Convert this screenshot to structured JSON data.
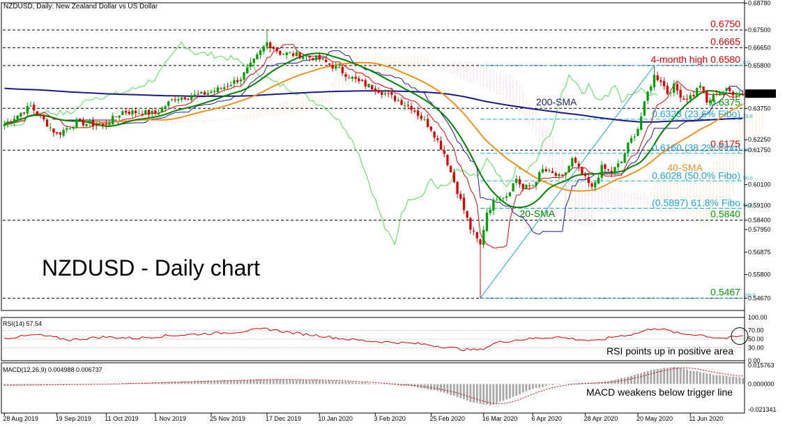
{
  "header": {
    "symbol_line": "NZDUSD, Daily:  New Zealand Dollar vs US Dollar",
    "big_title": "NZDUSD - Daily chart"
  },
  "colors": {
    "bull": "#00a000",
    "bear": "#e00000",
    "sma20": "#008000",
    "sma40": "#f0921e",
    "sma200": "#1a1a80",
    "tenkan": "#e00000",
    "kijun": "#1a1aa0",
    "chikou": "#50e050",
    "cloud_bear": "#f5a0c8",
    "cloud_bull": "#f8c890",
    "fibo": "#18a8d8",
    "level_red": "#e00000",
    "level_green": "#00a000"
  },
  "chart_data": [
    {
      "type": "candlestick",
      "title": "NZDUSD, Daily:  New Zealand Dollar vs US Dollar",
      "ylim": [
        0.5408,
        0.688
      ],
      "y_ticks": [
        "0.68780",
        "0.67500",
        "0.66650",
        "0.65800",
        "0.64454",
        "0.63750",
        "0.62250",
        "0.61750",
        "0.60100",
        "0.59100",
        "0.58400",
        "0.57950",
        "0.56875",
        "0.55800",
        "0.54670"
      ],
      "current_price": "0.64454",
      "x_tick_labels": [
        "28 Aug 2019",
        "19 Sep 2019",
        "11 Oct 2019",
        "1 Nov 2019",
        "25 Nov 2019",
        "17 Dec 2019",
        "10 Jan 2020",
        "3 Feb 2020",
        "25 Feb 2020",
        "16 Mar 2020",
        "6 Apr 2020",
        "28 Apr 2020",
        "20 May 2020",
        "11 Jun 2020"
      ],
      "x_tick_index": [
        0,
        16,
        31,
        46,
        63,
        80,
        96,
        113,
        130,
        146,
        161,
        177,
        193,
        209
      ],
      "bars_count": 226,
      "close_anchors": [
        [
          0,
          0.63
        ],
        [
          8,
          0.6385
        ],
        [
          16,
          0.625
        ],
        [
          22,
          0.631
        ],
        [
          30,
          0.629
        ],
        [
          36,
          0.636
        ],
        [
          46,
          0.635
        ],
        [
          52,
          0.6425
        ],
        [
          60,
          0.644
        ],
        [
          66,
          0.647
        ],
        [
          72,
          0.652
        ],
        [
          76,
          0.66
        ],
        [
          80,
          0.669
        ],
        [
          84,
          0.664
        ],
        [
          90,
          0.663
        ],
        [
          96,
          0.661
        ],
        [
          102,
          0.656
        ],
        [
          108,
          0.65
        ],
        [
          113,
          0.647
        ],
        [
          118,
          0.643
        ],
        [
          124,
          0.638
        ],
        [
          130,
          0.628
        ],
        [
          134,
          0.616
        ],
        [
          138,
          0.598
        ],
        [
          142,
          0.58
        ],
        [
          145,
          0.572
        ],
        [
          147,
          0.588
        ],
        [
          150,
          0.595
        ],
        [
          153,
          0.596
        ],
        [
          156,
          0.604
        ],
        [
          158,
          0.599
        ],
        [
          161,
          0.601
        ],
        [
          164,
          0.608
        ],
        [
          167,
          0.606
        ],
        [
          170,
          0.604
        ],
        [
          173,
          0.613
        ],
        [
          176,
          0.606
        ],
        [
          179,
          0.599
        ],
        [
          182,
          0.609
        ],
        [
          185,
          0.607
        ],
        [
          188,
          0.612
        ],
        [
          190,
          0.62
        ],
        [
          193,
          0.628
        ],
        [
          196,
          0.645
        ],
        [
          198,
          0.653
        ],
        [
          200,
          0.651
        ],
        [
          202,
          0.645
        ],
        [
          204,
          0.648
        ],
        [
          207,
          0.642
        ],
        [
          210,
          0.644
        ],
        [
          212,
          0.649
        ],
        [
          214,
          0.64
        ],
        [
          217,
          0.645
        ],
        [
          220,
          0.646
        ],
        [
          222,
          0.645
        ],
        [
          225,
          0.6445
        ]
      ],
      "wick_overrides": [
        [
          145,
          0.5467
        ],
        [
          198,
          0.658
        ],
        [
          80,
          0.675
        ]
      ],
      "levels": [
        {
          "price": 0.675,
          "label": "0.6750",
          "kind": "red"
        },
        {
          "price": 0.6665,
          "label": "0.6665",
          "kind": "red"
        },
        {
          "price": 0.658,
          "label": "4-month high 0.6580",
          "kind": "red"
        },
        {
          "price": 0.6375,
          "label": "0.6375",
          "kind": "green"
        },
        {
          "price": 0.6175,
          "label": "0.6175",
          "kind": "red"
        },
        {
          "price": 0.584,
          "label": "0.5840",
          "kind": "green"
        },
        {
          "price": 0.5467,
          "label": "0.5467",
          "kind": "green"
        }
      ],
      "fibo": {
        "start_index": 145,
        "end_index": 225,
        "levels": [
          {
            "price": 0.658,
            "label": "",
            "tag": "0.0"
          },
          {
            "price": 0.6323,
            "label": "0.6323 (23.6% Fibo)",
            "tag": "23.6"
          },
          {
            "price": 0.616,
            "label": "0.6160 (38.2% Fibo)",
            "tag": "38.2"
          },
          {
            "price": 0.6028,
            "label": "0.6028 (50.0% Fibo)",
            "tag": "50.0"
          },
          {
            "price": 0.5897,
            "label": "(0.5897) 61.8% Fibo",
            "tag": "61.8"
          },
          {
            "price": 0.5467,
            "label": "",
            "tag": "100.0"
          }
        ]
      },
      "sma_labels": [
        {
          "text": "200-SMA",
          "index": 162,
          "price": 0.639,
          "series": "sma200"
        },
        {
          "text": "40-SMA",
          "index": 202,
          "price": 0.6075,
          "series": "sma40"
        },
        {
          "text": "20-SMA",
          "index": 157,
          "price": 0.5855,
          "series": "sma20"
        }
      ]
    },
    {
      "type": "line",
      "title": "RSI(14) 57.54",
      "ylim": [
        0,
        100
      ],
      "y_ticks": [
        "100.00",
        "70.00",
        "50.00",
        "30.00",
        "0.00"
      ],
      "levels": [
        70,
        50,
        30
      ],
      "current_value": 57.54,
      "annotation": "RSI points up in positive area",
      "anchors": [
        [
          0,
          52
        ],
        [
          10,
          60
        ],
        [
          20,
          48
        ],
        [
          30,
          55
        ],
        [
          40,
          52
        ],
        [
          50,
          58
        ],
        [
          60,
          62
        ],
        [
          70,
          66
        ],
        [
          80,
          74
        ],
        [
          88,
          64
        ],
        [
          96,
          58
        ],
        [
          104,
          50
        ],
        [
          112,
          45
        ],
        [
          120,
          42
        ],
        [
          128,
          38
        ],
        [
          134,
          32
        ],
        [
          140,
          26
        ],
        [
          145,
          25
        ],
        [
          150,
          42
        ],
        [
          156,
          48
        ],
        [
          162,
          52
        ],
        [
          168,
          55
        ],
        [
          174,
          50
        ],
        [
          180,
          45
        ],
        [
          186,
          56
        ],
        [
          192,
          62
        ],
        [
          198,
          76
        ],
        [
          202,
          70
        ],
        [
          206,
          62
        ],
        [
          212,
          60
        ],
        [
          216,
          54
        ],
        [
          220,
          52
        ],
        [
          225,
          57.54
        ]
      ]
    },
    {
      "type": "bar",
      "title": "MACD(12,26,9) 0.004988 0.006737",
      "ylim": [
        -0.0244,
        0.0178
      ],
      "y_ticks": [
        "0.015763",
        "0.000000",
        "-0.021341"
      ],
      "macd": 0.004988,
      "signal": 0.006737,
      "annotation": "MACD weakens below trigger line",
      "anchors": [
        [
          0,
          -0.001
        ],
        [
          20,
          -0.0005
        ],
        [
          40,
          0.0008
        ],
        [
          60,
          0.0025
        ],
        [
          80,
          0.004
        ],
        [
          96,
          0.0032
        ],
        [
          110,
          0.001
        ],
        [
          124,
          -0.002
        ],
        [
          134,
          -0.007
        ],
        [
          142,
          -0.015
        ],
        [
          148,
          -0.018
        ],
        [
          154,
          -0.012
        ],
        [
          160,
          -0.005
        ],
        [
          166,
          -0.001
        ],
        [
          174,
          0.0008
        ],
        [
          182,
          0.0015
        ],
        [
          190,
          0.006
        ],
        [
          198,
          0.0125
        ],
        [
          204,
          0.0145
        ],
        [
          210,
          0.011
        ],
        [
          216,
          0.008
        ],
        [
          222,
          0.006
        ],
        [
          225,
          0.005
        ]
      ]
    }
  ]
}
